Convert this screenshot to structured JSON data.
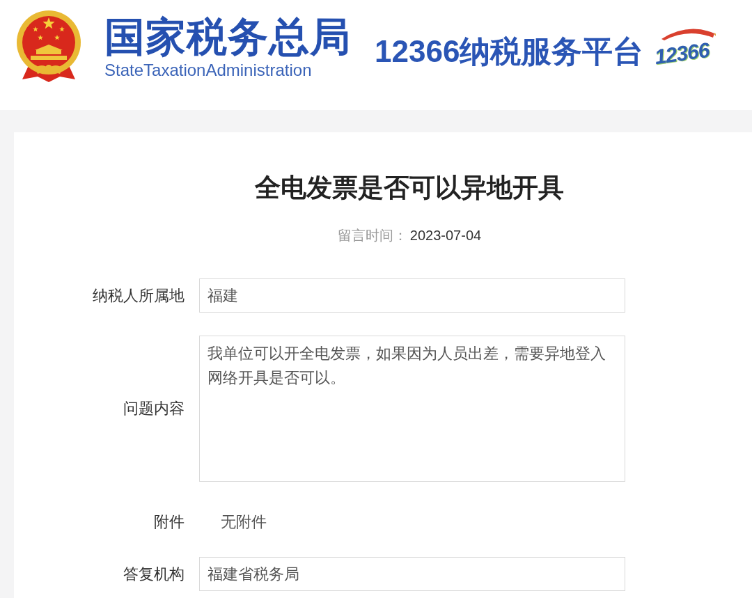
{
  "header": {
    "agency_name": "国家税务总局",
    "agency_name_en": "StateTaxationAdministration",
    "platform_name": "12366纳税服务平台",
    "platform_logo_text": "12366"
  },
  "article": {
    "title": "全电发票是否可以异地开具",
    "posted_label": "留言时间：",
    "posted_date": "2023-07-04"
  },
  "fields": [
    {
      "kind": "input",
      "label": "纳税人所属地",
      "value": "福建"
    },
    {
      "kind": "textarea",
      "label": "问题内容",
      "value": "我单位可以开全电发票，如果因为人员出差，需要异地登入网络开具是否可以。"
    },
    {
      "kind": "text",
      "label": "附件",
      "value": "无附件"
    },
    {
      "kind": "input",
      "label": "答复机构",
      "value": "福建省税务局"
    }
  ]
}
